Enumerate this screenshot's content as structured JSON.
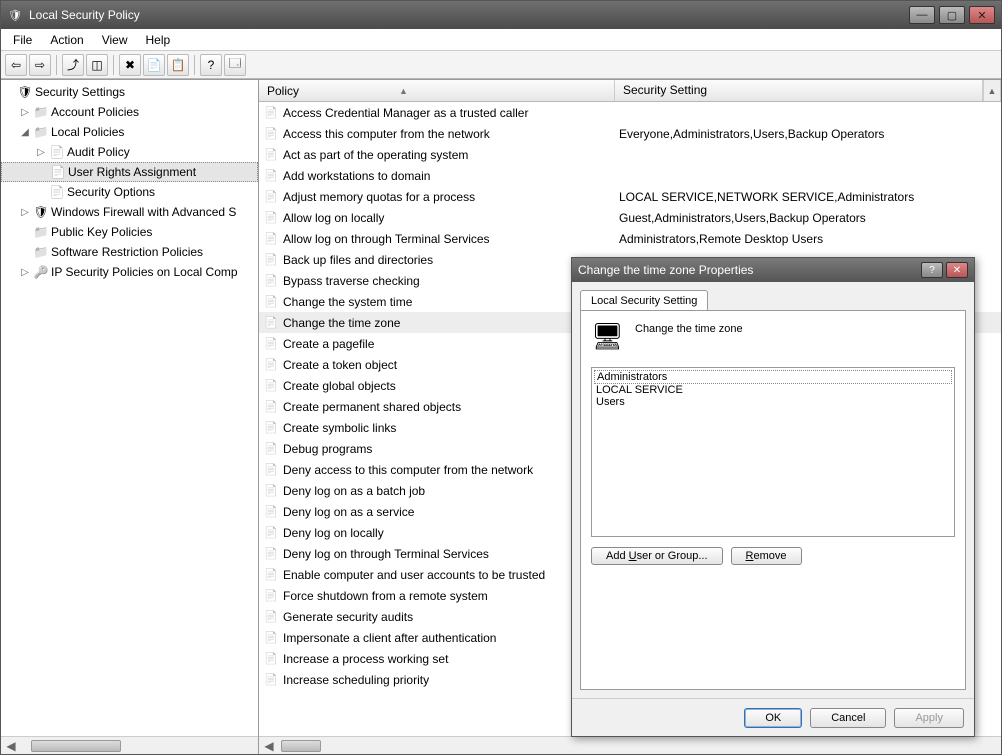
{
  "window": {
    "title": "Local Security Policy"
  },
  "menu": [
    "File",
    "Action",
    "View",
    "Help"
  ],
  "tree": {
    "root": "Security Settings",
    "items": [
      {
        "label": "Account Policies",
        "indent": 1,
        "expander": "▷",
        "icon": "folder"
      },
      {
        "label": "Local Policies",
        "indent": 1,
        "expander": "◢",
        "icon": "folder"
      },
      {
        "label": "Audit Policy",
        "indent": 2,
        "expander": "▷",
        "icon": "policy"
      },
      {
        "label": "User Rights Assignment",
        "indent": 2,
        "expander": " ",
        "icon": "policy",
        "selected": true
      },
      {
        "label": "Security Options",
        "indent": 2,
        "expander": " ",
        "icon": "policy"
      },
      {
        "label": "Windows Firewall with Advanced S",
        "indent": 1,
        "expander": "▷",
        "icon": "shield"
      },
      {
        "label": "Public Key Policies",
        "indent": 1,
        "expander": " ",
        "icon": "folder"
      },
      {
        "label": "Software Restriction Policies",
        "indent": 1,
        "expander": " ",
        "icon": "folder"
      },
      {
        "label": "IP Security Policies on Local Comp",
        "indent": 1,
        "expander": "▷",
        "icon": "key"
      }
    ]
  },
  "list": {
    "headers": {
      "policy": "Policy",
      "setting": "Security Setting"
    },
    "rows": [
      {
        "p": "Access Credential Manager as a trusted caller",
        "s": ""
      },
      {
        "p": "Access this computer from the network",
        "s": "Everyone,Administrators,Users,Backup Operators"
      },
      {
        "p": "Act as part of the operating system",
        "s": ""
      },
      {
        "p": "Add workstations to domain",
        "s": ""
      },
      {
        "p": "Adjust memory quotas for a process",
        "s": "LOCAL SERVICE,NETWORK SERVICE,Administrators"
      },
      {
        "p": "Allow log on locally",
        "s": "Guest,Administrators,Users,Backup Operators"
      },
      {
        "p": "Allow log on through Terminal Services",
        "s": "Administrators,Remote Desktop Users"
      },
      {
        "p": "Back up files and directories",
        "s": ""
      },
      {
        "p": "Bypass traverse checking",
        "s": ""
      },
      {
        "p": "Change the system time",
        "s": ""
      },
      {
        "p": "Change the time zone",
        "s": "",
        "selected": true
      },
      {
        "p": "Create a pagefile",
        "s": ""
      },
      {
        "p": "Create a token object",
        "s": ""
      },
      {
        "p": "Create global objects",
        "s": ""
      },
      {
        "p": "Create permanent shared objects",
        "s": ""
      },
      {
        "p": "Create symbolic links",
        "s": ""
      },
      {
        "p": "Debug programs",
        "s": ""
      },
      {
        "p": "Deny access to this computer from the network",
        "s": ""
      },
      {
        "p": "Deny log on as a batch job",
        "s": ""
      },
      {
        "p": "Deny log on as a service",
        "s": ""
      },
      {
        "p": "Deny log on locally",
        "s": ""
      },
      {
        "p": "Deny log on through Terminal Services",
        "s": ""
      },
      {
        "p": "Enable computer and user accounts to be trusted",
        "s": ""
      },
      {
        "p": "Force shutdown from a remote system",
        "s": ""
      },
      {
        "p": "Generate security audits",
        "s": ""
      },
      {
        "p": "Impersonate a client after authentication",
        "s": ""
      },
      {
        "p": "Increase a process working set",
        "s": ""
      },
      {
        "p": "Increase scheduling priority",
        "s": ""
      }
    ]
  },
  "dialog": {
    "title": "Change the time zone Properties",
    "tab": "Local Security Setting",
    "heading": "Change the time zone",
    "members": [
      "Administrators",
      "LOCAL SERVICE",
      "Users"
    ],
    "add": "Add User or Group...",
    "remove": "Remove",
    "ok": "OK",
    "cancel": "Cancel",
    "apply": "Apply"
  }
}
